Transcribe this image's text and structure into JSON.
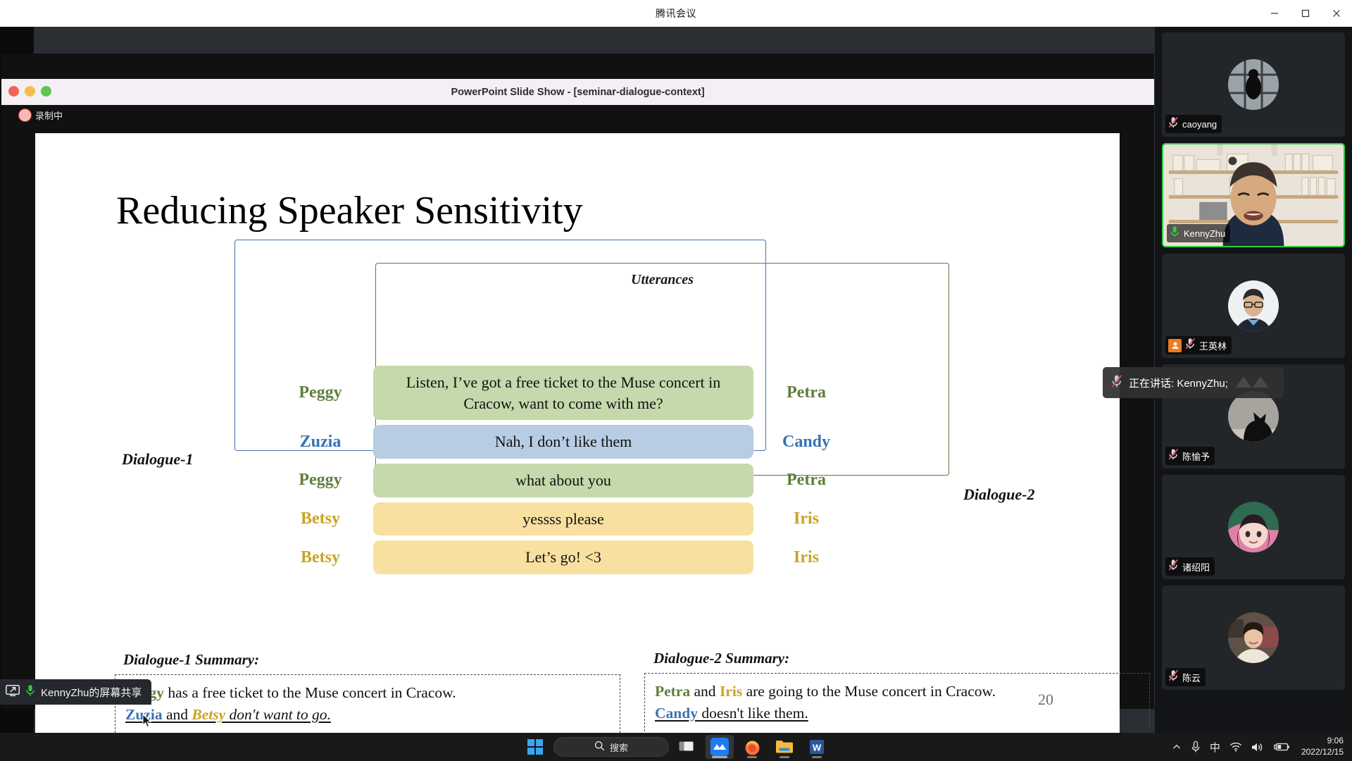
{
  "app": {
    "title": "腾讯会议",
    "window_buttons": {
      "minimize": "minimize-icon",
      "maximize": "maximize-icon",
      "close": "close-icon"
    }
  },
  "shared_window": {
    "title": "PowerPoint Slide Show - [seminar-dialogue-context]",
    "recording_label": "录制中",
    "traffic_lights": [
      "close",
      "minimize",
      "zoom"
    ]
  },
  "slide": {
    "title": "Reducing Speaker Sensitivity",
    "utterances_label": "Utterances",
    "dialogue1_label": "Dialogue-1",
    "dialogue2_label": "Dialogue-2",
    "page_number": "20",
    "rows": [
      {
        "left_speaker": "Peggy",
        "left_color": "green",
        "text": "Listen, I’ve got a free ticket to the Muse concert in Cracow, want to come with me?",
        "bubble_color": "green",
        "right_speaker": "Petra",
        "right_color": "green"
      },
      {
        "left_speaker": "Zuzia",
        "left_color": "blue",
        "text": "Nah, I don’t like them",
        "bubble_color": "blue",
        "right_speaker": "Candy",
        "right_color": "blue"
      },
      {
        "left_speaker": "Peggy",
        "left_color": "green",
        "text": "what about you",
        "bubble_color": "green",
        "right_speaker": "Petra",
        "right_color": "green"
      },
      {
        "left_speaker": "Betsy",
        "left_color": "gold",
        "text": "yessss please",
        "bubble_color": "yellow",
        "right_speaker": "Iris",
        "right_color": "gold"
      },
      {
        "left_speaker": "Betsy",
        "left_color": "gold",
        "text": "Let’s go!  <3",
        "bubble_color": "yellow",
        "right_speaker": "Iris",
        "right_color": "gold"
      }
    ],
    "summary1": {
      "title": "Dialogue-1 Summary:",
      "line1_name": "Peggy",
      "line1_rest": " has a free ticket to the Muse concert in Cracow.",
      "line2_name1": "Zuzia",
      "line2_mid": " and ",
      "line2_name2": "Betsy",
      "line2_rest": " don't want to go."
    },
    "summary2": {
      "title": "Dialogue-2 Summary:",
      "line1_name1": "Petra",
      "line1_mid": " and ",
      "line1_name2": "Iris",
      "line1_rest": " are going to the Muse concert in Cracow.",
      "line2_name": "Candy",
      "line2_rest": " doesn't like them."
    },
    "colors": {
      "green_name": "#5f7f3c",
      "blue_name": "#3a72b0",
      "gold_name": "#c9a227",
      "bubble_green": "#c5d9ac",
      "bubble_blue": "#b8cde4",
      "bubble_yellow": "#f8e0a0",
      "box_d1_border": "#4574a8",
      "box_d2_border": "#5c7a42"
    }
  },
  "share_indicator": {
    "label": "KennyZhu的屏幕共享"
  },
  "speaking_toast": {
    "label": "正在讲话: KennyZhu;"
  },
  "participants": [
    {
      "name": "caoyang",
      "muted": true,
      "speaking": false,
      "host": false,
      "video": false,
      "avatar_kind": "bird-window-photo"
    },
    {
      "name": "KennyZhu",
      "muted": false,
      "speaking": true,
      "host": false,
      "video": true,
      "avatar_kind": "man-bookshelf-camera"
    },
    {
      "name": "王英林",
      "muted": true,
      "speaking": false,
      "host": true,
      "video": false,
      "avatar_kind": "man-glasses-suit-photo"
    },
    {
      "name": "陈愉予",
      "muted": true,
      "speaking": false,
      "host": false,
      "video": false,
      "avatar_kind": "cat-silhouette-photo"
    },
    {
      "name": "诸绍阳",
      "muted": true,
      "speaking": false,
      "host": false,
      "video": false,
      "avatar_kind": "anime-girl-photo"
    },
    {
      "name": "陈云",
      "muted": true,
      "speaking": false,
      "host": false,
      "video": false,
      "avatar_kind": "woman-indoor-photo"
    }
  ],
  "taskbar": {
    "search_placeholder": "搜索",
    "items": [
      {
        "name": "start",
        "icon": "windows-logo-icon"
      },
      {
        "name": "search",
        "icon": "search-icon"
      },
      {
        "name": "task-view",
        "icon": "task-view-icon"
      },
      {
        "name": "tencent-meeting",
        "icon": "tencent-meeting-icon",
        "active": true
      },
      {
        "name": "firefox",
        "icon": "firefox-icon",
        "active": false,
        "running": true
      },
      {
        "name": "file-explorer",
        "icon": "folder-icon",
        "active": false,
        "running": true
      },
      {
        "name": "word",
        "icon": "word-icon",
        "active": false,
        "running": true
      }
    ],
    "tray": {
      "overflow": "chevron-up-icon",
      "microphone": "microphone-icon",
      "ime": "中",
      "wifi": "wifi-icon",
      "volume": "speaker-icon",
      "battery": "battery-charging-icon",
      "time": "9:06",
      "date": "2022/12/15"
    }
  }
}
